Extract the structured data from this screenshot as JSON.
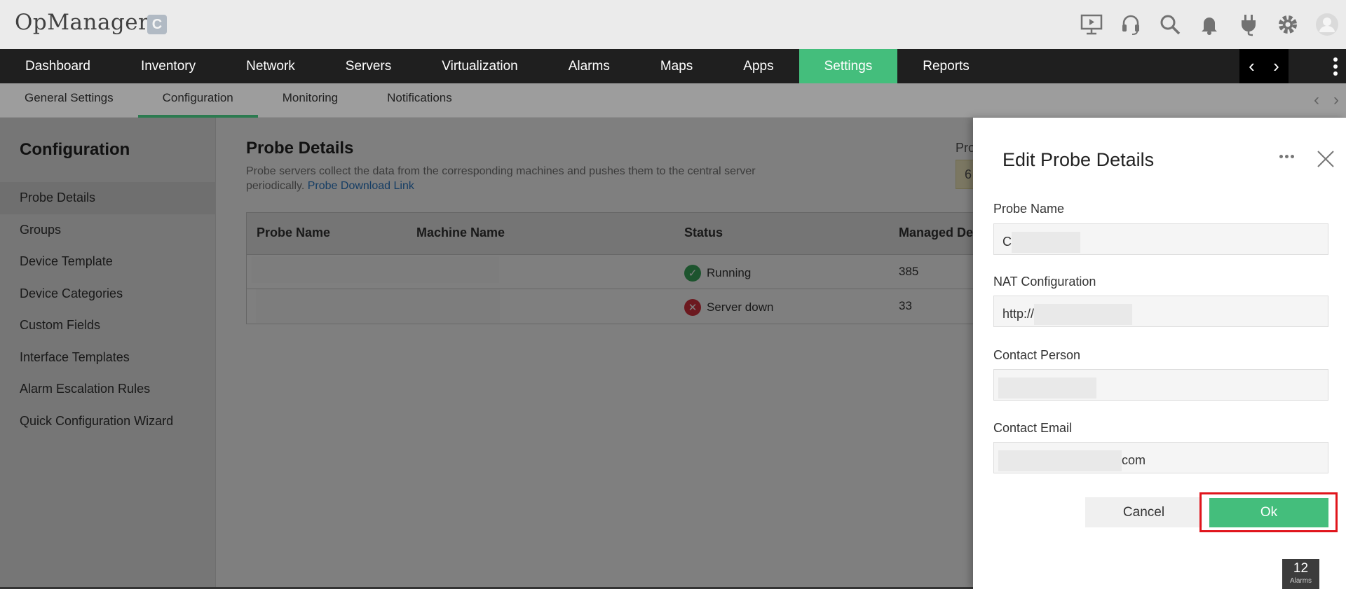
{
  "app": {
    "title": "OpManager",
    "badge": "C"
  },
  "header_icons": [
    "presentation-icon",
    "headset-icon",
    "search-icon",
    "bell-icon",
    "plug-icon",
    "gear-icon",
    "user-avatar-icon"
  ],
  "main_nav": {
    "tabs": [
      "Dashboard",
      "Inventory",
      "Network",
      "Servers",
      "Virtualization",
      "Alarms",
      "Maps",
      "Apps",
      "Settings",
      "Reports"
    ],
    "active": "Settings",
    "prev": "‹",
    "next": "›"
  },
  "sub_nav": {
    "tabs": [
      "General Settings",
      "Configuration",
      "Monitoring",
      "Notifications"
    ],
    "active": "Configuration",
    "prev": "‹",
    "next": "›"
  },
  "sidebar": {
    "title": "Configuration",
    "items": [
      "Probe Details",
      "Groups",
      "Device Template",
      "Device Categories",
      "Custom Fields",
      "Interface Templates",
      "Alarm Escalation Rules",
      "Quick Configuration Wizard"
    ],
    "active": "Probe Details"
  },
  "main": {
    "title": "Probe Details",
    "description": "Probe servers collect the data from the corresponding machines and pushes them to the central server periodically.",
    "link": "Probe Download Link",
    "right_stub_label": "Pro",
    "right_stub_value": "6"
  },
  "table": {
    "headers": [
      "Probe Name",
      "Machine Name",
      "Status",
      "Managed De"
    ],
    "rows": [
      {
        "status": "Running",
        "status_type": "ok",
        "managed": "385"
      },
      {
        "status": "Server down",
        "status_type": "error",
        "managed": "33"
      }
    ]
  },
  "panel": {
    "title": "Edit Probe Details",
    "fields": [
      {
        "label": "Probe Name",
        "value": "C"
      },
      {
        "label": "NAT Configuration",
        "value": "http://"
      },
      {
        "label": "Contact Person",
        "value": ""
      },
      {
        "label": "Contact Email",
        "value": "com"
      }
    ],
    "cancel_label": "Cancel",
    "ok_label": "Ok"
  },
  "alarm_badge": {
    "count": "12",
    "label": "Alarms"
  },
  "colors": {
    "accent": "#44be7c",
    "nav_bg": "#1f1f1f",
    "highlight": "#e0151c",
    "link": "#2a7ac8"
  }
}
